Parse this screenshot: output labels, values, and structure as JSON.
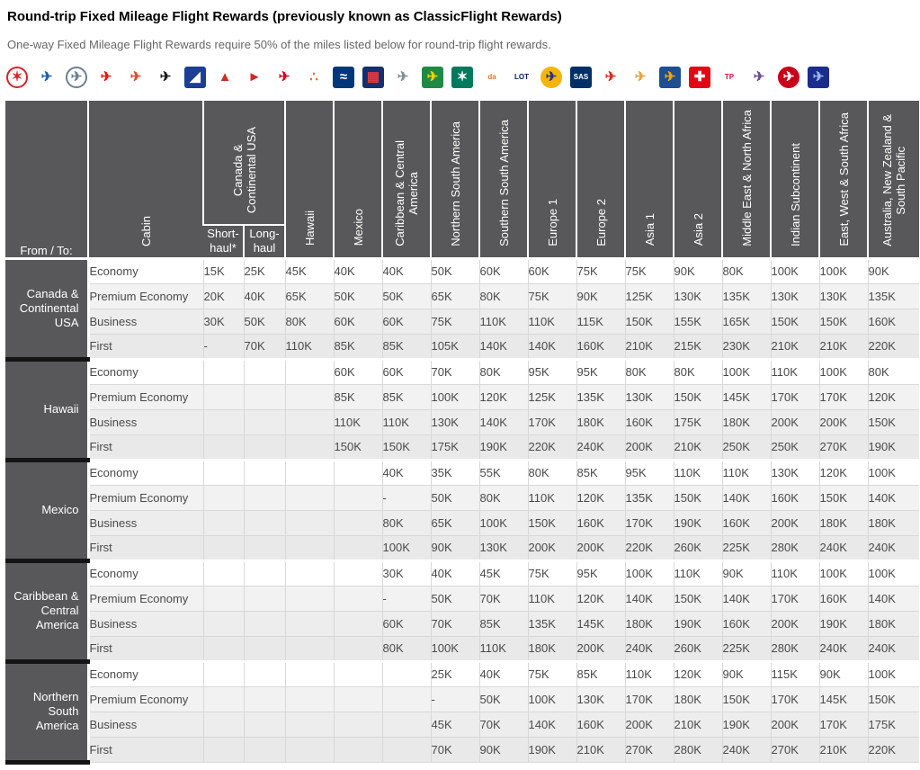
{
  "page": {
    "title": "Round-trip Fixed Mileage Flight Rewards (previously known as ClassicFlight Rewards)",
    "subtitle": "One-way Fixed Mileage Flight Rewards require 50% of the miles listed below for round-trip flight rewards."
  },
  "colors": {
    "header_bg": "#58585a",
    "group_separator": "#141414",
    "cell_border": "#d8d8d8",
    "row_economy": "#ffffff",
    "row_premium_economy": "#f2f2f2",
    "row_business": "#ededed",
    "row_first": "#e9e9e9",
    "header_text": "#ffffff",
    "body_text": "#4a4a4a"
  },
  "logos": [
    {
      "name": "air-canada",
      "shape": "ring",
      "bg": "#ffffff",
      "fg": "#d8232a",
      "glyph": "✶"
    },
    {
      "name": "adria-airways",
      "shape": "glyph",
      "bg": "",
      "fg": "#1960ab",
      "glyph": "✈"
    },
    {
      "name": "aegean-airlines",
      "shape": "ring",
      "bg": "#ffffff",
      "fg": "#6b7f92",
      "glyph": "✈"
    },
    {
      "name": "air-china",
      "shape": "glyph",
      "bg": "",
      "fg": "#e3170d",
      "glyph": "✈"
    },
    {
      "name": "air-india",
      "shape": "glyph",
      "bg": "",
      "fg": "#e0482d",
      "glyph": "✈"
    },
    {
      "name": "air-new-zealand",
      "shape": "glyph",
      "bg": "",
      "fg": "#1a1a1a",
      "glyph": "✈"
    },
    {
      "name": "ana",
      "shape": "square",
      "bg": "#1c3e93",
      "fg": "#ffffff",
      "glyph": "◢"
    },
    {
      "name": "asiana-airlines",
      "shape": "glyph",
      "bg": "",
      "fg": "#cf2e24",
      "glyph": "▲"
    },
    {
      "name": "austrian-airlines",
      "shape": "glyph",
      "bg": "",
      "fg": "#d2232a",
      "glyph": "►"
    },
    {
      "name": "avianca",
      "shape": "glyph",
      "bg": "",
      "fg": "#d6001c",
      "glyph": "✈"
    },
    {
      "name": "brussels-airlines",
      "shape": "glyph",
      "bg": "",
      "fg": "#ef6a24",
      "glyph": "∴"
    },
    {
      "name": "copa-airlines",
      "shape": "square",
      "bg": "#00377b",
      "fg": "#ffffff",
      "glyph": "≈"
    },
    {
      "name": "croatia-airlines",
      "shape": "square",
      "bg": "#12316e",
      "fg": "#e03a3e",
      "glyph": "▦"
    },
    {
      "name": "egyptair",
      "shape": "glyph",
      "bg": "",
      "fg": "#7f8c99",
      "glyph": "✈"
    },
    {
      "name": "ethiopian-airlines",
      "shape": "square",
      "bg": "#1f8a44",
      "fg": "#ffd200",
      "glyph": "✈"
    },
    {
      "name": "eva-air",
      "shape": "square",
      "bg": "#007a5e",
      "fg": "#ffffff",
      "glyph": "✶"
    },
    {
      "name": "orange-script-airline",
      "shape": "text",
      "bg": "",
      "fg": "#e87722",
      "glyph": "da"
    },
    {
      "name": "lot-polish-airlines",
      "shape": "text",
      "bg": "",
      "fg": "#001c64",
      "glyph": "LOT"
    },
    {
      "name": "lufthansa",
      "shape": "circle",
      "bg": "#f5b50a",
      "fg": "#283583",
      "glyph": "✈"
    },
    {
      "name": "sas",
      "shape": "square text",
      "bg": "#003066",
      "fg": "#ffffff",
      "glyph": "SAS"
    },
    {
      "name": "shenzhen-airlines",
      "shape": "glyph",
      "bg": "",
      "fg": "#e02a1d",
      "glyph": "✈"
    },
    {
      "name": "singapore-airlines",
      "shape": "glyph",
      "bg": "",
      "fg": "#e8a33d",
      "glyph": "✈"
    },
    {
      "name": "south-african-airways",
      "shape": "square",
      "bg": "#1d4f91",
      "fg": "#f5a800",
      "glyph": "✈"
    },
    {
      "name": "swiss",
      "shape": "square",
      "bg": "#e30613",
      "fg": "#ffffff",
      "glyph": "✚"
    },
    {
      "name": "tap-portugal",
      "shape": "text",
      "bg": "",
      "fg": "#d0103a",
      "glyph": "TP"
    },
    {
      "name": "thai-airways",
      "shape": "glyph",
      "bg": "",
      "fg": "#6a4c93",
      "glyph": "✈"
    },
    {
      "name": "turkish-airlines",
      "shape": "circle",
      "bg": "#c90019",
      "fg": "#ffffff",
      "glyph": "✈"
    },
    {
      "name": "united-airlines",
      "shape": "square",
      "bg": "#1b2c8f",
      "fg": "#9db7e8",
      "glyph": "✈"
    }
  ],
  "table": {
    "corner_label": "From / To:",
    "cabin_header": "Cabin",
    "group_header": "Canada &\nContinental USA",
    "subheaders": [
      "Short-haul*",
      "Long-haul"
    ],
    "destination_headers": [
      "Hawaii",
      "Mexico",
      "Caribbean & Central\nAmerica",
      "Northern South America",
      "Southern South America",
      "Europe 1",
      "Europe 2",
      "Asia 1",
      "Asia 2",
      "Middle East & North Africa",
      "Indian Subcontinent",
      "East, West & South Africa",
      "Australia, New Zealand &\nSouth Pacific"
    ],
    "groups": [
      {
        "origin": "Canada &\nContinental\nUSA",
        "rows": [
          {
            "cabin": "Economy",
            "values": [
              "15K",
              "25K",
              "45K",
              "40K",
              "40K",
              "50K",
              "60K",
              "60K",
              "75K",
              "75K",
              "90K",
              "80K",
              "100K",
              "100K",
              "90K"
            ]
          },
          {
            "cabin": "Premium Economy",
            "values": [
              "20K",
              "40K",
              "65K",
              "50K",
              "50K",
              "65K",
              "80K",
              "75K",
              "90K",
              "125K",
              "130K",
              "135K",
              "130K",
              "130K",
              "135K"
            ]
          },
          {
            "cabin": "Business",
            "values": [
              "30K",
              "50K",
              "80K",
              "60K",
              "60K",
              "75K",
              "110K",
              "110K",
              "115K",
              "150K",
              "155K",
              "165K",
              "150K",
              "150K",
              "160K"
            ]
          },
          {
            "cabin": "First",
            "values": [
              "-",
              "70K",
              "110K",
              "85K",
              "85K",
              "105K",
              "140K",
              "140K",
              "160K",
              "210K",
              "215K",
              "230K",
              "210K",
              "210K",
              "220K"
            ]
          }
        ]
      },
      {
        "origin": "Hawaii",
        "rows": [
          {
            "cabin": "Economy",
            "values": [
              "",
              "",
              "",
              "60K",
              "60K",
              "70K",
              "80K",
              "95K",
              "95K",
              "80K",
              "80K",
              "100K",
              "110K",
              "100K",
              "80K"
            ]
          },
          {
            "cabin": "Premium Economy",
            "values": [
              "",
              "",
              "",
              "85K",
              "85K",
              "100K",
              "120K",
              "125K",
              "135K",
              "130K",
              "150K",
              "145K",
              "170K",
              "170K",
              "120K"
            ]
          },
          {
            "cabin": "Business",
            "values": [
              "",
              "",
              "",
              "110K",
              "110K",
              "130K",
              "140K",
              "170K",
              "180K",
              "160K",
              "175K",
              "180K",
              "200K",
              "200K",
              "150K"
            ]
          },
          {
            "cabin": "First",
            "values": [
              "",
              "",
              "",
              "150K",
              "150K",
              "175K",
              "190K",
              "220K",
              "240K",
              "200K",
              "210K",
              "250K",
              "250K",
              "270K",
              "190K"
            ]
          }
        ]
      },
      {
        "origin": "Mexico",
        "rows": [
          {
            "cabin": "Economy",
            "values": [
              "",
              "",
              "",
              "",
              "40K",
              "35K",
              "55K",
              "80K",
              "85K",
              "95K",
              "110K",
              "110K",
              "130K",
              "120K",
              "100K"
            ]
          },
          {
            "cabin": "Premium Economy",
            "values": [
              "",
              "",
              "",
              "",
              "-",
              "50K",
              "80K",
              "110K",
              "120K",
              "135K",
              "150K",
              "140K",
              "160K",
              "150K",
              "140K"
            ]
          },
          {
            "cabin": "Business",
            "values": [
              "",
              "",
              "",
              "",
              "80K",
              "65K",
              "100K",
              "150K",
              "160K",
              "170K",
              "190K",
              "160K",
              "200K",
              "180K",
              "180K"
            ]
          },
          {
            "cabin": "First",
            "values": [
              "",
              "",
              "",
              "",
              "100K",
              "90K",
              "130K",
              "200K",
              "200K",
              "220K",
              "260K",
              "225K",
              "280K",
              "240K",
              "240K"
            ]
          }
        ]
      },
      {
        "origin": "Caribbean &\nCentral\nAmerica",
        "rows": [
          {
            "cabin": "Economy",
            "values": [
              "",
              "",
              "",
              "",
              "30K",
              "40K",
              "45K",
              "75K",
              "95K",
              "100K",
              "110K",
              "90K",
              "110K",
              "100K",
              "100K"
            ]
          },
          {
            "cabin": "Premium Economy",
            "values": [
              "",
              "",
              "",
              "",
              "-",
              "50K",
              "70K",
              "110K",
              "120K",
              "140K",
              "150K",
              "140K",
              "170K",
              "160K",
              "140K"
            ]
          },
          {
            "cabin": "Business",
            "values": [
              "",
              "",
              "",
              "",
              "60K",
              "70K",
              "85K",
              "135K",
              "145K",
              "180K",
              "190K",
              "160K",
              "200K",
              "190K",
              "180K"
            ]
          },
          {
            "cabin": "First",
            "values": [
              "",
              "",
              "",
              "",
              "80K",
              "100K",
              "110K",
              "180K",
              "200K",
              "240K",
              "260K",
              "225K",
              "280K",
              "240K",
              "240K"
            ]
          }
        ]
      },
      {
        "origin": "Northern\nSouth\nAmerica",
        "rows": [
          {
            "cabin": "Economy",
            "values": [
              "",
              "",
              "",
              "",
              "",
              "25K",
              "40K",
              "75K",
              "85K",
              "110K",
              "120K",
              "90K",
              "115K",
              "90K",
              "100K"
            ]
          },
          {
            "cabin": "Premium Economy",
            "values": [
              "",
              "",
              "",
              "",
              "",
              "-",
              "50K",
              "100K",
              "130K",
              "170K",
              "180K",
              "150K",
              "170K",
              "145K",
              "150K"
            ]
          },
          {
            "cabin": "Business",
            "values": [
              "",
              "",
              "",
              "",
              "",
              "45K",
              "70K",
              "140K",
              "160K",
              "200K",
              "210K",
              "190K",
              "200K",
              "170K",
              "175K"
            ]
          },
          {
            "cabin": "First",
            "values": [
              "",
              "",
              "",
              "",
              "",
              "70K",
              "90K",
              "190K",
              "210K",
              "270K",
              "280K",
              "240K",
              "270K",
              "210K",
              "220K"
            ]
          }
        ]
      }
    ]
  }
}
